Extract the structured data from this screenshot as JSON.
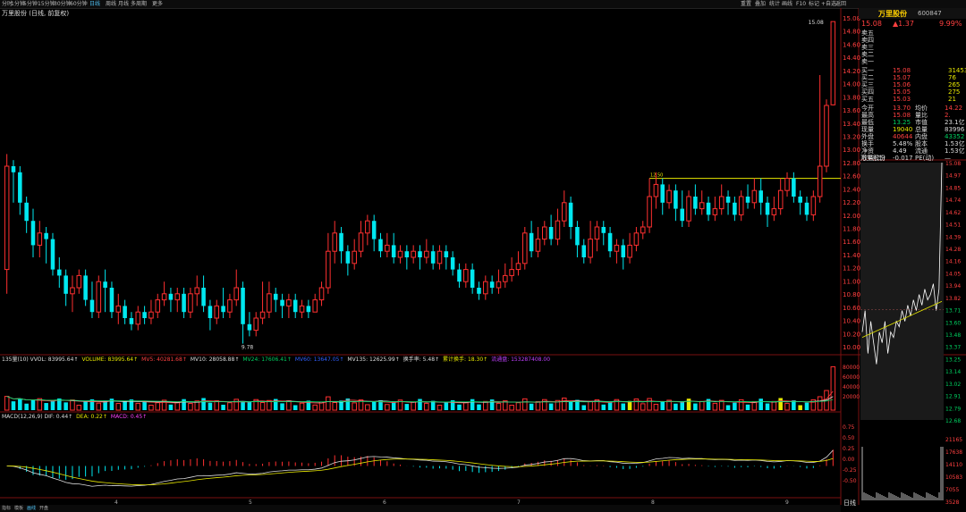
{
  "toolbar": {
    "items": [
      "分时",
      "1分钟",
      "5分钟",
      "15分钟",
      "30分钟",
      "60分钟",
      "日线",
      "周线",
      "月线",
      "多周期",
      "更多"
    ],
    "active_index": 6,
    "right_items": [
      "重置",
      "叠加",
      "统计",
      "画线",
      "F10",
      "标记",
      "+自选",
      "返回"
    ]
  },
  "stock": {
    "title": "万里股份 (日线, 前复权)",
    "name": "万里股份",
    "code": "600847",
    "price": "15.08",
    "change": "▲1.37",
    "change_pct": "9.99%"
  },
  "chart_data": {
    "type": "candlestick",
    "axis": {
      "price_ticks": [
        "15.08",
        "14.80",
        "14.60",
        "14.40",
        "14.20",
        "14.00",
        "13.80",
        "13.60",
        "13.40",
        "13.20",
        "13.00",
        "12.80",
        "12.60",
        "12.40",
        "12.20",
        "12.00",
        "11.80",
        "11.60",
        "11.40",
        "11.20",
        "11.00",
        "10.80",
        "10.60",
        "10.40",
        "10.20",
        "10.00"
      ],
      "ylim": [
        9.7,
        15.2
      ]
    },
    "annotations": {
      "high": "15.08",
      "low": "9.78",
      "level": "12.50"
    },
    "candles": [
      [
        11.0,
        12.7,
        10.6,
        12.9
      ],
      [
        12.7,
        12.6,
        12.1,
        12.8
      ],
      [
        12.6,
        12.1,
        11.9,
        12.7
      ],
      [
        12.1,
        11.8,
        11.6,
        12.2
      ],
      [
        11.8,
        11.4,
        11.2,
        12.0
      ],
      [
        11.4,
        11.6,
        11.2,
        11.8
      ],
      [
        11.6,
        11.5,
        11.1,
        11.7
      ],
      [
        11.5,
        11.0,
        10.9,
        11.6
      ],
      [
        11.0,
        10.9,
        10.7,
        11.2
      ],
      [
        10.9,
        10.6,
        10.4,
        11.0
      ],
      [
        10.6,
        10.7,
        10.3,
        10.9
      ],
      [
        10.7,
        10.9,
        10.6,
        11.0
      ],
      [
        10.9,
        10.5,
        10.4,
        11.0
      ],
      [
        10.5,
        10.3,
        10.2,
        10.8
      ],
      [
        10.3,
        10.8,
        10.2,
        10.9
      ],
      [
        10.8,
        10.7,
        10.3,
        11.0
      ],
      [
        10.7,
        10.3,
        10.2,
        10.8
      ],
      [
        10.3,
        10.4,
        10.1,
        10.6
      ],
      [
        10.4,
        10.2,
        10.1,
        10.5
      ],
      [
        10.2,
        10.1,
        10.0,
        10.3
      ],
      [
        10.1,
        10.3,
        10.0,
        10.4
      ],
      [
        10.3,
        10.2,
        10.1,
        10.4
      ],
      [
        10.2,
        10.3,
        10.1,
        10.5
      ],
      [
        10.3,
        10.5,
        10.2,
        10.6
      ],
      [
        10.5,
        10.6,
        10.4,
        10.8
      ],
      [
        10.6,
        10.5,
        10.3,
        10.7
      ],
      [
        10.5,
        10.6,
        10.3,
        10.7
      ],
      [
        10.6,
        10.3,
        10.2,
        10.7
      ],
      [
        10.3,
        10.6,
        10.2,
        10.7
      ],
      [
        10.6,
        10.7,
        10.4,
        10.9
      ],
      [
        10.7,
        10.4,
        10.3,
        10.9
      ],
      [
        10.4,
        10.2,
        10.0,
        10.5
      ],
      [
        10.2,
        10.4,
        10.1,
        10.5
      ],
      [
        10.4,
        10.3,
        10.2,
        10.7
      ],
      [
        10.3,
        10.5,
        10.2,
        10.6
      ],
      [
        10.5,
        10.7,
        10.4,
        11.0
      ],
      [
        10.7,
        10.1,
        9.78,
        10.8
      ],
      [
        10.1,
        10.0,
        9.9,
        10.3
      ],
      [
        10.0,
        10.2,
        9.9,
        10.3
      ],
      [
        10.2,
        10.3,
        10.1,
        10.8
      ],
      [
        10.3,
        10.6,
        10.2,
        10.8
      ],
      [
        10.6,
        10.5,
        10.3,
        10.7
      ],
      [
        10.5,
        10.4,
        10.2,
        10.6
      ],
      [
        10.4,
        10.5,
        10.2,
        10.6
      ],
      [
        10.5,
        10.3,
        10.2,
        10.6
      ],
      [
        10.3,
        10.4,
        10.2,
        10.5
      ],
      [
        10.4,
        10.3,
        10.2,
        10.5
      ],
      [
        10.3,
        10.5,
        10.3,
        10.6
      ],
      [
        10.5,
        10.7,
        10.4,
        10.8
      ],
      [
        10.7,
        11.3,
        10.6,
        11.6
      ],
      [
        11.3,
        11.6,
        11.1,
        11.8
      ],
      [
        11.6,
        11.3,
        11.1,
        11.7
      ],
      [
        11.3,
        11.1,
        10.9,
        11.4
      ],
      [
        11.1,
        11.3,
        11.0,
        11.5
      ],
      [
        11.3,
        11.6,
        11.2,
        11.8
      ],
      [
        11.6,
        11.8,
        11.4,
        11.9
      ],
      [
        11.8,
        11.5,
        11.3,
        11.9
      ],
      [
        11.5,
        11.3,
        11.2,
        11.6
      ],
      [
        11.3,
        11.4,
        11.2,
        11.6
      ],
      [
        11.4,
        11.2,
        11.1,
        11.6
      ],
      [
        11.2,
        11.3,
        11.1,
        11.4
      ],
      [
        11.3,
        11.2,
        11.0,
        11.4
      ],
      [
        11.2,
        11.3,
        11.1,
        11.4
      ],
      [
        11.3,
        11.2,
        11.0,
        11.4
      ],
      [
        11.2,
        11.3,
        11.1,
        11.5
      ],
      [
        11.3,
        11.1,
        11.0,
        11.4
      ],
      [
        11.1,
        11.3,
        11.0,
        11.4
      ],
      [
        11.3,
        11.2,
        11.0,
        11.4
      ],
      [
        11.2,
        11.0,
        10.9,
        11.3
      ],
      [
        11.0,
        10.8,
        10.7,
        11.1
      ],
      [
        10.8,
        11.0,
        10.7,
        11.1
      ],
      [
        11.0,
        10.7,
        10.6,
        11.1
      ],
      [
        10.7,
        10.6,
        10.5,
        10.8
      ],
      [
        10.6,
        10.8,
        10.5,
        10.9
      ],
      [
        10.8,
        10.7,
        10.6,
        10.9
      ],
      [
        10.7,
        10.8,
        10.6,
        11.0
      ],
      [
        10.8,
        10.9,
        10.7,
        11.1
      ],
      [
        10.9,
        11.0,
        10.8,
        11.2
      ],
      [
        11.0,
        11.1,
        10.9,
        11.3
      ],
      [
        11.1,
        11.6,
        11.0,
        11.7
      ],
      [
        11.6,
        11.3,
        11.2,
        11.8
      ],
      [
        11.3,
        11.5,
        11.2,
        11.7
      ],
      [
        11.5,
        11.7,
        11.4,
        11.8
      ],
      [
        11.7,
        11.5,
        11.4,
        11.9
      ],
      [
        11.5,
        11.8,
        11.4,
        12.0
      ],
      [
        11.8,
        12.1,
        11.7,
        12.3
      ],
      [
        12.1,
        11.7,
        11.5,
        12.2
      ],
      [
        11.7,
        11.4,
        11.2,
        11.8
      ],
      [
        11.4,
        11.2,
        11.1,
        11.5
      ],
      [
        11.2,
        11.5,
        11.1,
        11.8
      ],
      [
        11.5,
        11.7,
        11.3,
        11.8
      ],
      [
        11.7,
        11.6,
        11.4,
        11.8
      ],
      [
        11.6,
        11.3,
        11.2,
        11.7
      ],
      [
        11.3,
        11.4,
        11.1,
        11.5
      ],
      [
        11.4,
        11.2,
        11.0,
        11.5
      ],
      [
        11.2,
        11.4,
        11.1,
        11.6
      ],
      [
        11.4,
        11.6,
        11.3,
        11.7
      ],
      [
        11.6,
        11.7,
        11.5,
        11.8
      ],
      [
        11.7,
        12.2,
        11.6,
        12.5
      ],
      [
        12.2,
        12.4,
        12.0,
        12.6
      ],
      [
        12.4,
        12.1,
        11.9,
        12.5
      ],
      [
        12.1,
        12.3,
        12.0,
        12.4
      ],
      [
        12.3,
        12.0,
        11.8,
        12.4
      ],
      [
        12.0,
        11.8,
        11.7,
        12.3
      ],
      [
        11.8,
        12.2,
        11.7,
        12.3
      ],
      [
        12.2,
        12.0,
        11.9,
        12.4
      ],
      [
        12.0,
        12.1,
        11.9,
        12.3
      ],
      [
        12.1,
        11.9,
        11.8,
        12.2
      ],
      [
        11.9,
        12.0,
        11.8,
        12.2
      ],
      [
        12.0,
        12.2,
        11.9,
        12.4
      ],
      [
        12.2,
        12.1,
        11.9,
        12.3
      ],
      [
        12.1,
        11.9,
        11.8,
        12.2
      ],
      [
        11.9,
        12.2,
        11.8,
        12.3
      ],
      [
        12.2,
        12.1,
        12.0,
        12.4
      ],
      [
        12.1,
        12.3,
        12.0,
        12.5
      ],
      [
        12.3,
        12.1,
        11.9,
        12.5
      ],
      [
        12.1,
        11.9,
        11.7,
        12.2
      ],
      [
        11.9,
        12.0,
        11.8,
        12.2
      ],
      [
        12.0,
        12.3,
        11.9,
        12.5
      ],
      [
        12.3,
        12.5,
        12.2,
        12.6
      ],
      [
        12.5,
        12.2,
        12.1,
        12.6
      ],
      [
        12.2,
        12.1,
        11.9,
        12.3
      ],
      [
        12.1,
        11.9,
        11.8,
        12.2
      ],
      [
        11.9,
        12.2,
        11.8,
        12.3
      ],
      [
        12.2,
        12.7,
        12.1,
        14.2
      ],
      [
        12.7,
        13.7,
        12.6,
        13.8
      ],
      [
        13.71,
        15.08,
        13.7,
        15.08
      ]
    ],
    "volume_ticks": [
      "80000",
      "60000",
      "40000",
      "20000"
    ],
    "macd_ticks": [
      "0.75",
      "0.50",
      "0.25",
      "0.00",
      "-0.25",
      "-0.50"
    ],
    "x_ticks": [
      "4",
      "5",
      "6",
      "7",
      "8",
      "9"
    ],
    "intraday_ticks": [
      "15.08",
      "14.97",
      "14.85",
      "14.74",
      "14.62",
      "14.51",
      "14.39",
      "14.28",
      "14.16",
      "14.05",
      "13.94",
      "13.82",
      "13.71",
      "13.60",
      "13.48",
      "13.37",
      "13.25",
      "13.14",
      "13.02",
      "12.91",
      "12.79",
      "12.68"
    ],
    "intraday_vol_ticks": [
      "21165",
      "17638",
      "14110",
      "10583",
      "7055",
      "3528"
    ]
  },
  "indicators": {
    "vol_line": [
      {
        "text": "135量(10) VVOL: 83995.64↑",
        "color": "#dddddd"
      },
      {
        "text": "VOLUME: 83995.64↑",
        "color": "#e8e800"
      },
      {
        "text": "MV5: 40281.68↑",
        "color": "#ff4040"
      },
      {
        "text": "MV10: 28058.88↑",
        "color": "#dddddd"
      },
      {
        "text": "MV24: 17606.41↑",
        "color": "#00d060"
      },
      {
        "text": "MV60: 13647.05↑",
        "color": "#3060ff"
      },
      {
        "text": "MV135: 12625.99↑",
        "color": "#dddddd"
      },
      {
        "text": "换手率: 5.48↑",
        "color": "#dddddd"
      },
      {
        "text": "累计换手: 18.30↑",
        "color": "#e8e800"
      },
      {
        "text": "流通盘: 153287408.00",
        "color": "#c040ff"
      }
    ],
    "macd_line": [
      {
        "text": "MACD(12,26,9) DIF: 0.44↑",
        "color": "#dddddd"
      },
      {
        "text": "DEA: 0.22↑",
        "color": "#e8e800"
      },
      {
        "text": "MACD: 0.45↑",
        "color": "#ff40ff"
      }
    ]
  },
  "quote": {
    "sell": [
      [
        "卖五",
        "",
        ""
      ],
      [
        "卖四",
        "",
        ""
      ],
      [
        "卖三",
        "",
        ""
      ],
      [
        "卖二",
        "",
        ""
      ],
      [
        "卖一",
        "",
        ""
      ]
    ],
    "buy": [
      [
        "买一",
        "15.08",
        "31453"
      ],
      [
        "买二",
        "15.07",
        "76"
      ],
      [
        "买三",
        "15.06",
        "265"
      ],
      [
        "买四",
        "15.05",
        "275"
      ],
      [
        "买五",
        "15.03",
        "21"
      ]
    ],
    "stats": [
      [
        "今开",
        "13.70",
        "均价",
        "14.22"
      ],
      [
        "最高",
        "15.08",
        "量比",
        "2."
      ],
      [
        "最低",
        "13.25",
        "市值",
        "23.1亿"
      ],
      [
        "现量",
        "19040",
        "总量",
        "83996"
      ],
      [
        "外盘",
        "40644",
        "内盘",
        "43352"
      ],
      [
        "换手",
        "5.48%",
        "股本",
        "1.53亿"
      ],
      [
        "净资",
        "4.49",
        "流通",
        "1.53亿"
      ],
      [
        "收益(二)",
        "-0.017",
        "PE(动)",
        "—"
      ]
    ],
    "intraday_title": "万里股份"
  },
  "period_tabs": [
    "指标",
    "模板",
    "画线",
    "开盘"
  ],
  "bottom_label": "日线"
}
